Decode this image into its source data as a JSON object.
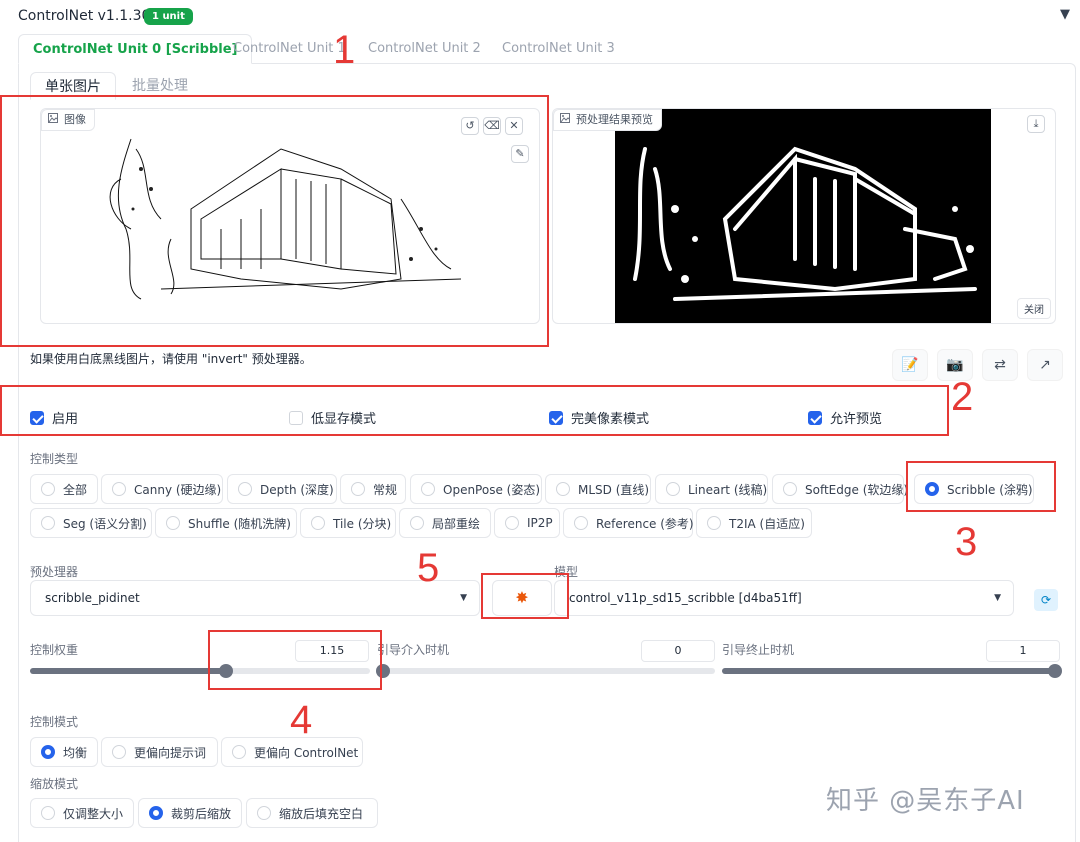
{
  "header": {
    "title": "ControlNet v1.1.306",
    "badge": "1 unit",
    "collapse_icon": "triangle-down-icon"
  },
  "tabs": [
    {
      "label": "ControlNet Unit 0 [Scribble]",
      "active": true
    },
    {
      "label": "ControlNet Unit 1",
      "active": false
    },
    {
      "label": "ControlNet Unit 2",
      "active": false
    },
    {
      "label": "ControlNet Unit 3",
      "active": false
    }
  ],
  "subtabs": [
    {
      "label": "单张图片",
      "active": true
    },
    {
      "label": "批量处理",
      "active": false
    }
  ],
  "image_panel": {
    "label": "图像"
  },
  "preview_panel": {
    "label": "预处理结果预览",
    "close_label": "关闭"
  },
  "hint": "如果使用白底黑线图片，请使用 \"invert\" 预处理器。",
  "checkboxes": [
    {
      "label": "启用",
      "checked": true
    },
    {
      "label": "低显存模式",
      "checked": false
    },
    {
      "label": "完美像素模式",
      "checked": true
    },
    {
      "label": "允许预览",
      "checked": true
    }
  ],
  "control_type": {
    "label": "控制类型",
    "options": [
      "全部",
      "Canny (硬边缘)",
      "Depth (深度)",
      "常规",
      "OpenPose (姿态)",
      "MLSD (直线)",
      "Lineart (线稿)",
      "SoftEdge (软边缘)",
      "Scribble (涂鸦)",
      "Seg (语义分割)",
      "Shuffle (随机洗牌)",
      "Tile (分块)",
      "局部重绘",
      "IP2P",
      "Reference (参考)",
      "T2IA (自适应)"
    ],
    "selected": "Scribble (涂鸦)"
  },
  "preprocessor": {
    "label": "预处理器",
    "value": "scribble_pidinet"
  },
  "model": {
    "label": "模型",
    "value": "control_v11p_sd15_scribble [d4ba51ff]"
  },
  "sliders": {
    "weight": {
      "label": "控制权重",
      "value": "1.15",
      "fraction": 0.575
    },
    "start": {
      "label": "引导介入时机",
      "value": "0",
      "fraction": 0.0
    },
    "end": {
      "label": "引导终止时机",
      "value": "1",
      "fraction": 1.0
    }
  },
  "control_mode": {
    "label": "控制模式",
    "options": [
      "均衡",
      "更偏向提示词",
      "更偏向 ControlNet"
    ],
    "selected": "均衡"
  },
  "resize_mode": {
    "label": "缩放模式",
    "options": [
      "仅调整大小",
      "裁剪后缩放",
      "缩放后填充空白"
    ],
    "selected": "裁剪后缩放"
  },
  "annotations": [
    "1",
    "2",
    "3",
    "4",
    "5"
  ],
  "watermark": "知乎 @吴东子AI",
  "colors": {
    "accent": "#16a34a",
    "primary": "#2563eb",
    "annotation": "#e53935"
  }
}
